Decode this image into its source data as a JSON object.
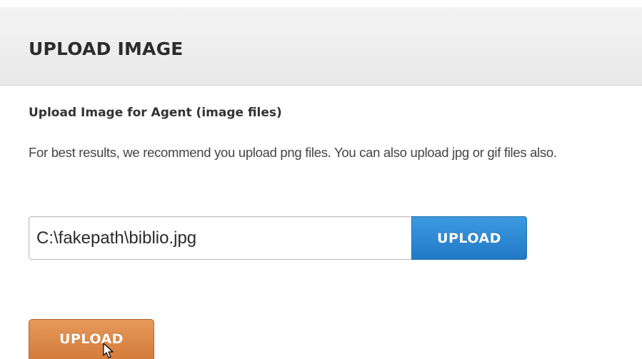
{
  "panel": {
    "title": "UPLOAD IMAGE"
  },
  "form": {
    "section_label": "Upload Image for Agent (image files)",
    "help_text": "For best results, we recommend you upload png files. You can also upload jpg or gif files also.",
    "file_input": {
      "value": "C:\\fakepath\\biblio.jpg"
    },
    "file_upload_label": "UPLOAD",
    "submit_label": "UPLOAD"
  },
  "colors": {
    "header_bg": "#eeeeee",
    "primary_blue": "#2a85d0",
    "accent_orange": "#dd8442"
  },
  "icons": {
    "cursor": "mouse-pointer-icon"
  }
}
